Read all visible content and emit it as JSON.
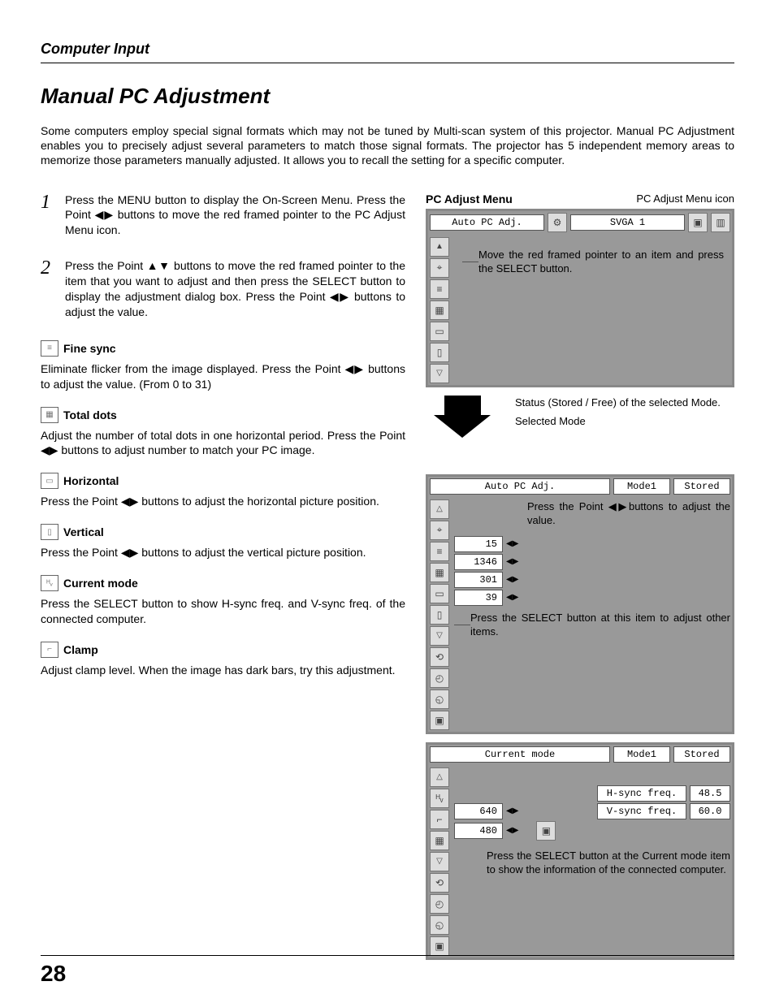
{
  "header": "Computer Input",
  "title": "Manual PC Adjustment",
  "intro": "Some computers employ special signal formats which may not be tuned by Multi-scan system of this projector. Manual PC Adjustment enables you to precisely adjust several parameters to match those signal formats.  The projector has 5 independent memory areas to memorize those parameters manually adjusted.  It allows you to recall the setting for a specific computer.",
  "steps": [
    {
      "num": "1",
      "text": "Press the MENU button to display the On-Screen Menu.  Press the Point ◀▶ buttons to move the red framed pointer to the PC Adjust Menu icon."
    },
    {
      "num": "2",
      "text": "Press the Point ▲▼ buttons to move the red framed pointer to the item that you want to adjust and then press the SELECT button to display the adjustment dialog box.  Press the Point ◀▶ buttons to adjust the value."
    }
  ],
  "items": [
    {
      "icon": "≡",
      "label": "Fine sync",
      "body": "Eliminate flicker from the image displayed.  Press the Point ◀▶ buttons to adjust the value.  (From 0 to 31)"
    },
    {
      "icon": "▦",
      "label": "Total dots",
      "body": "Adjust the number of total dots in one horizontal period.  Press the Point ◀▶ buttons to  adjust number to match your PC image."
    },
    {
      "icon": "▭",
      "label": "Horizontal",
      "body": "Press the Point ◀▶ buttons to adjust the horizontal picture position."
    },
    {
      "icon": "▯",
      "label": "Vertical",
      "body": "Press the Point ◀▶ buttons to adjust the vertical picture position."
    },
    {
      "icon": "ᴴᵥ",
      "label": "Current mode",
      "body": "Press the SELECT button to show H-sync freq. and V-sync freq. of the connected computer."
    },
    {
      "icon": "⌐",
      "label": "Clamp",
      "body": "Adjust clamp level.  When the image has dark bars, try this adjustment."
    }
  ],
  "right": {
    "menu_title": "PC Adjust Menu",
    "icon_label": "PC Adjust Menu icon",
    "top_bar": {
      "cell1": "Auto PC Adj.",
      "cell2": "SVGA 1"
    },
    "note1": "Move the red framed pointer to an item and press the SELECT button.",
    "status_label": "Status (Stored / Free) of the selected Mode.",
    "selected_mode_label": "Selected Mode",
    "mid_bar": {
      "c1": "Auto PC Adj.",
      "c2": "Mode1",
      "c3": "Stored"
    },
    "note2": "Press the Point ◀▶buttons to adjust the value.",
    "values": [
      "15",
      "1346",
      "301",
      "39"
    ],
    "note3": "Press the SELECT button at this item to adjust other items.",
    "curr_bar": {
      "c1": "Current mode",
      "c2": "Mode1",
      "c3": "Stored"
    },
    "dims": [
      "640",
      "480"
    ],
    "freq": [
      {
        "k": "H-sync freq.",
        "v": "48.5"
      },
      {
        "k": "V-sync freq.",
        "v": "60.0"
      }
    ],
    "note4": "Press the SELECT button at the Current mode item to show the information of the connected computer."
  },
  "page": "28"
}
